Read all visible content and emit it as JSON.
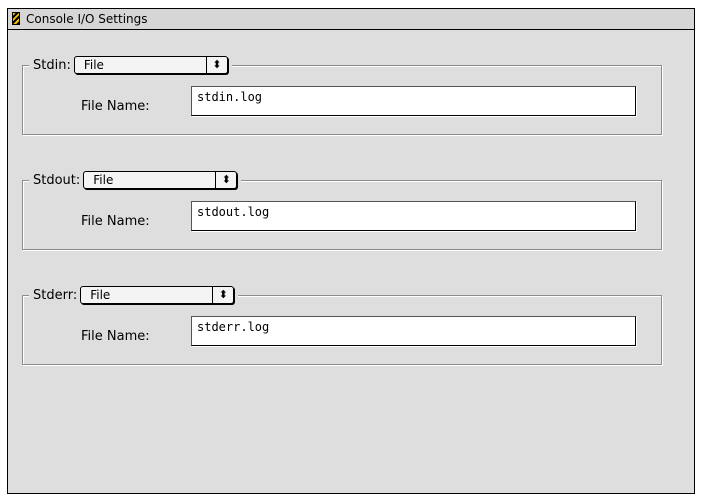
{
  "window": {
    "title": "Console I/O Settings"
  },
  "groups": [
    {
      "label": "Stdin:",
      "popup_value": "File",
      "popup_arrow": "⬍",
      "file_label": "File Name:",
      "file_value": "stdin.log"
    },
    {
      "label": "Stdout:",
      "popup_value": "File",
      "popup_arrow": "⬍",
      "file_label": "File Name:",
      "file_value": "stdout.log"
    },
    {
      "label": "Stderr:",
      "popup_value": "File",
      "popup_arrow": "⬍",
      "file_label": "File Name:",
      "file_value": "stderr.log"
    }
  ],
  "icons": {
    "title_icon": "window-app-icon",
    "popup_icon": "up-down-arrows-icon"
  },
  "colors": {
    "window_background": "#dedede",
    "title_bar": "#d6d6d6",
    "text_field": "#ffffff",
    "border": "#000000",
    "group_border": "#8c8c8c"
  }
}
